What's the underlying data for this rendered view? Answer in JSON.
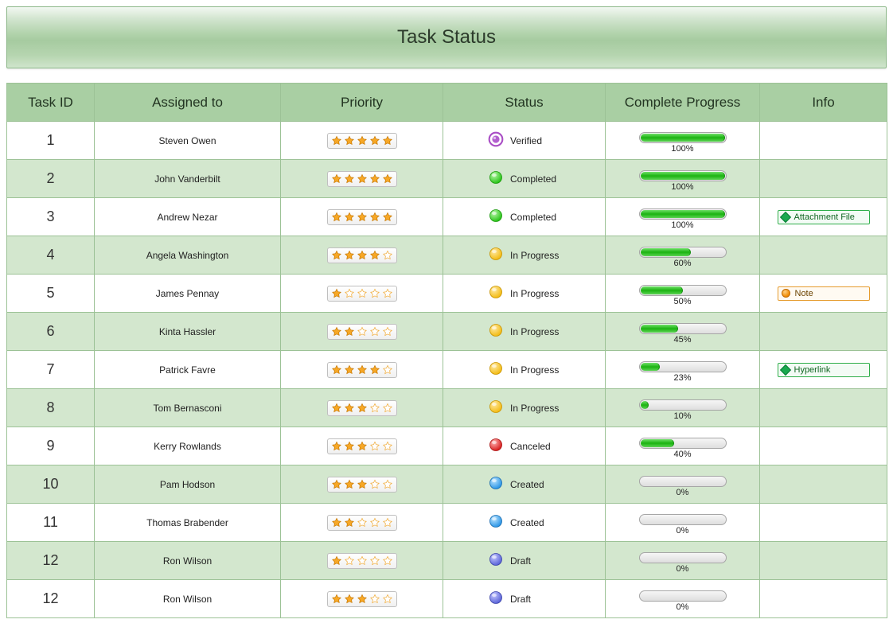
{
  "title": "Task Status",
  "columns": [
    "Task ID",
    "Assigned to",
    "Priority",
    "Status",
    "Complete Progress",
    "Info"
  ],
  "rows": [
    {
      "id": "1",
      "assigned": "Steven Owen",
      "priority": 5,
      "status_key": "verified",
      "status_label": "Verified",
      "progress": 100,
      "info": null
    },
    {
      "id": "2",
      "assigned": "John Vanderbilt",
      "priority": 5,
      "status_key": "completed",
      "status_label": "Completed",
      "progress": 100,
      "info": null
    },
    {
      "id": "3",
      "assigned": "Andrew Nezar",
      "priority": 5,
      "status_key": "completed",
      "status_label": "Completed",
      "progress": 100,
      "info": {
        "kind": "green",
        "text": "Attachment File"
      }
    },
    {
      "id": "4",
      "assigned": "Angela Washington",
      "priority": 4,
      "status_key": "inprogress",
      "status_label": "In Progress",
      "progress": 60,
      "info": null
    },
    {
      "id": "5",
      "assigned": "James Pennay",
      "priority": 1,
      "status_key": "inprogress",
      "status_label": "In Progress",
      "progress": 50,
      "info": {
        "kind": "orange",
        "text": "Note"
      }
    },
    {
      "id": "6",
      "assigned": "Kinta Hassler",
      "priority": 2,
      "status_key": "inprogress",
      "status_label": "In Progress",
      "progress": 45,
      "info": null
    },
    {
      "id": "7",
      "assigned": "Patrick Favre",
      "priority": 4,
      "status_key": "inprogress",
      "status_label": "In Progress",
      "progress": 23,
      "info": {
        "kind": "green",
        "text": "Hyperlink"
      }
    },
    {
      "id": "8",
      "assigned": "Tom Bernasconi",
      "priority": 3,
      "status_key": "inprogress",
      "status_label": "In Progress",
      "progress": 10,
      "info": null
    },
    {
      "id": "9",
      "assigned": "Kerry Rowlands",
      "priority": 3,
      "status_key": "canceled",
      "status_label": "Canceled",
      "progress": 40,
      "info": null
    },
    {
      "id": "10",
      "assigned": "Pam Hodson",
      "priority": 3,
      "status_key": "created",
      "status_label": "Created",
      "progress": 0,
      "info": null
    },
    {
      "id": "11",
      "assigned": "Thomas Brabender",
      "priority": 2,
      "status_key": "created",
      "status_label": "Created",
      "progress": 0,
      "info": null
    },
    {
      "id": "12",
      "assigned": "Ron Wilson",
      "priority": 1,
      "status_key": "draft",
      "status_label": "Draft",
      "progress": 0,
      "info": null
    },
    {
      "id": "12",
      "assigned": "Ron Wilson",
      "priority": 3,
      "status_key": "draft",
      "status_label": "Draft",
      "progress": 0,
      "info": null
    }
  ],
  "status_colors": {
    "verified": {
      "type": "ring",
      "ring": "#a94dc5",
      "fill": "#b35fcf"
    },
    "completed": {
      "type": "orb",
      "c1": "#b8f7a9",
      "c2": "#28c317",
      "stroke": "#1a9a0c"
    },
    "inprogress": {
      "type": "orb",
      "c1": "#ffe9a3",
      "c2": "#f3bb13",
      "stroke": "#c99400"
    },
    "canceled": {
      "type": "orb",
      "c1": "#ffb3b3",
      "c2": "#d81e1e",
      "stroke": "#a80f0f"
    },
    "created": {
      "type": "orb",
      "c1": "#b9e3ff",
      "c2": "#2a95e6",
      "stroke": "#1a6db0"
    },
    "draft": {
      "type": "orb",
      "c1": "#c4c7ff",
      "c2": "#5a63d8",
      "stroke": "#3c44a8"
    }
  },
  "star_colors": {
    "filled_fill": "#f7a826",
    "filled_stroke": "#c77700",
    "empty_fill": "#ffffff",
    "empty_stroke": "#f0a830"
  }
}
